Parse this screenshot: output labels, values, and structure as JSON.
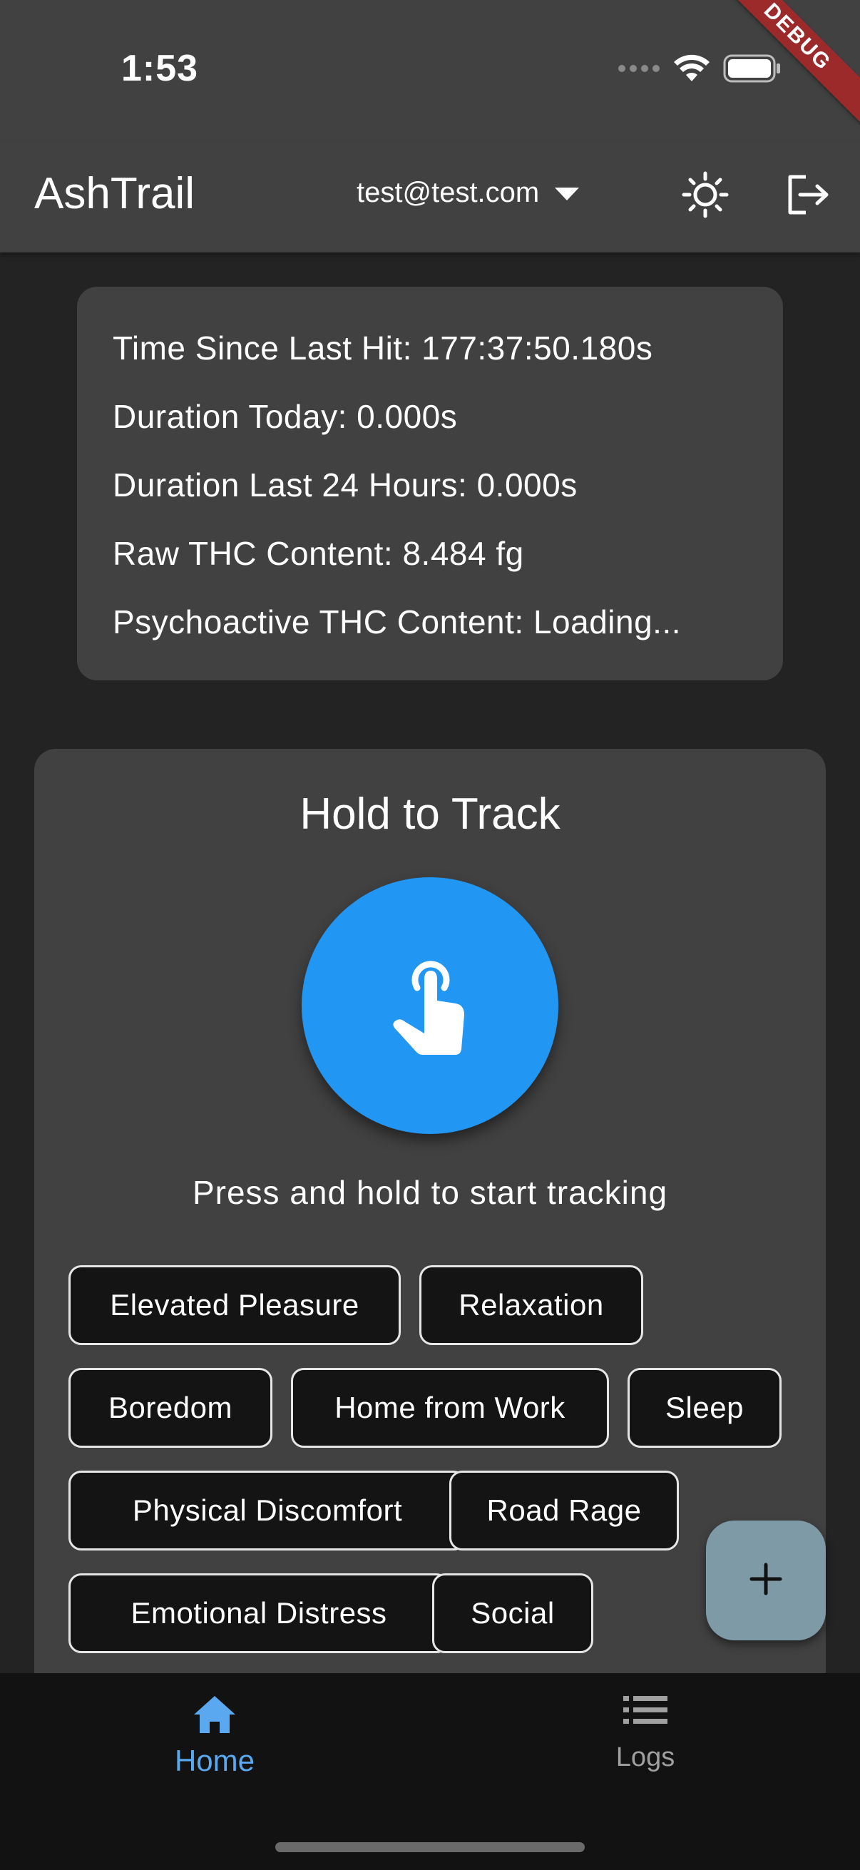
{
  "status_bar": {
    "time": "1:53"
  },
  "debug_banner": "DEBUG",
  "app_bar": {
    "title": "AshTrail",
    "account": "test@test.com"
  },
  "stats": {
    "time_since_last_hit": "Time Since Last Hit: 177:37:50.180s",
    "duration_today": "Duration Today: 0.000s",
    "duration_last_24h": "Duration Last 24 Hours: 0.000s",
    "raw_thc": "Raw THC Content: 8.484 fg",
    "psychoactive_thc": "Psychoactive THC Content: Loading..."
  },
  "tracker": {
    "title": "Hold to Track",
    "hint": "Press and hold to start tracking",
    "reasons": [
      "Elevated Pleasure",
      "Relaxation",
      "Boredom",
      "Home from Work",
      "Sleep",
      "Physical Discomfort",
      "Road Rage",
      "Emotional Distress",
      "Social"
    ]
  },
  "fab": {
    "icon": "plus-icon"
  },
  "bottom_nav": {
    "items": [
      {
        "label": "Home",
        "icon": "home-icon",
        "active": true
      },
      {
        "label": "Logs",
        "icon": "list-icon",
        "active": false
      }
    ]
  },
  "colors": {
    "accent": "#2196f3",
    "nav_active": "#5aa8f0",
    "nav_inactive": "#a0a0a0",
    "fab": "#7e9aa7",
    "card": "#414141",
    "background": "#232323"
  }
}
